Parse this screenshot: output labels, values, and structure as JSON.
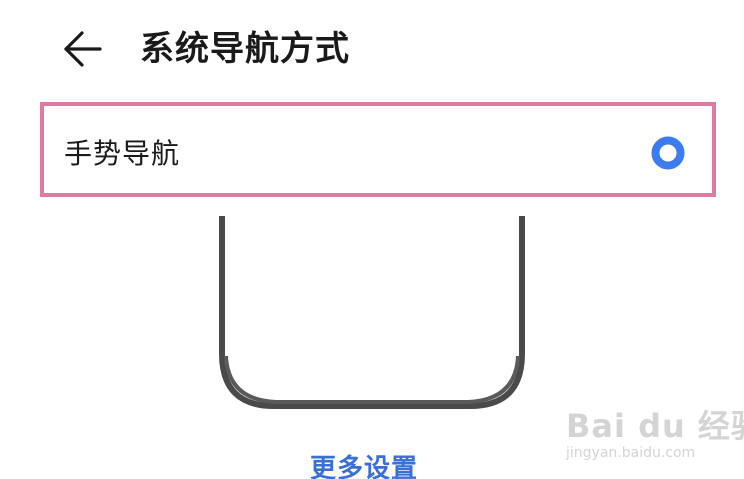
{
  "header": {
    "title": "系统导航方式",
    "back_icon": "arrow-left-icon"
  },
  "option": {
    "label": "手势导航",
    "selected": true,
    "radio_color": "#3d7bf0",
    "highlight_color": "#e07aa0"
  },
  "preview": {
    "frame_color": "#4a4a4a"
  },
  "more_settings": {
    "label": "更多设置",
    "color": "#3a6fd8"
  },
  "watermark": {
    "main": "Bai du 经验",
    "sub": "jingyan.baidu.com"
  }
}
